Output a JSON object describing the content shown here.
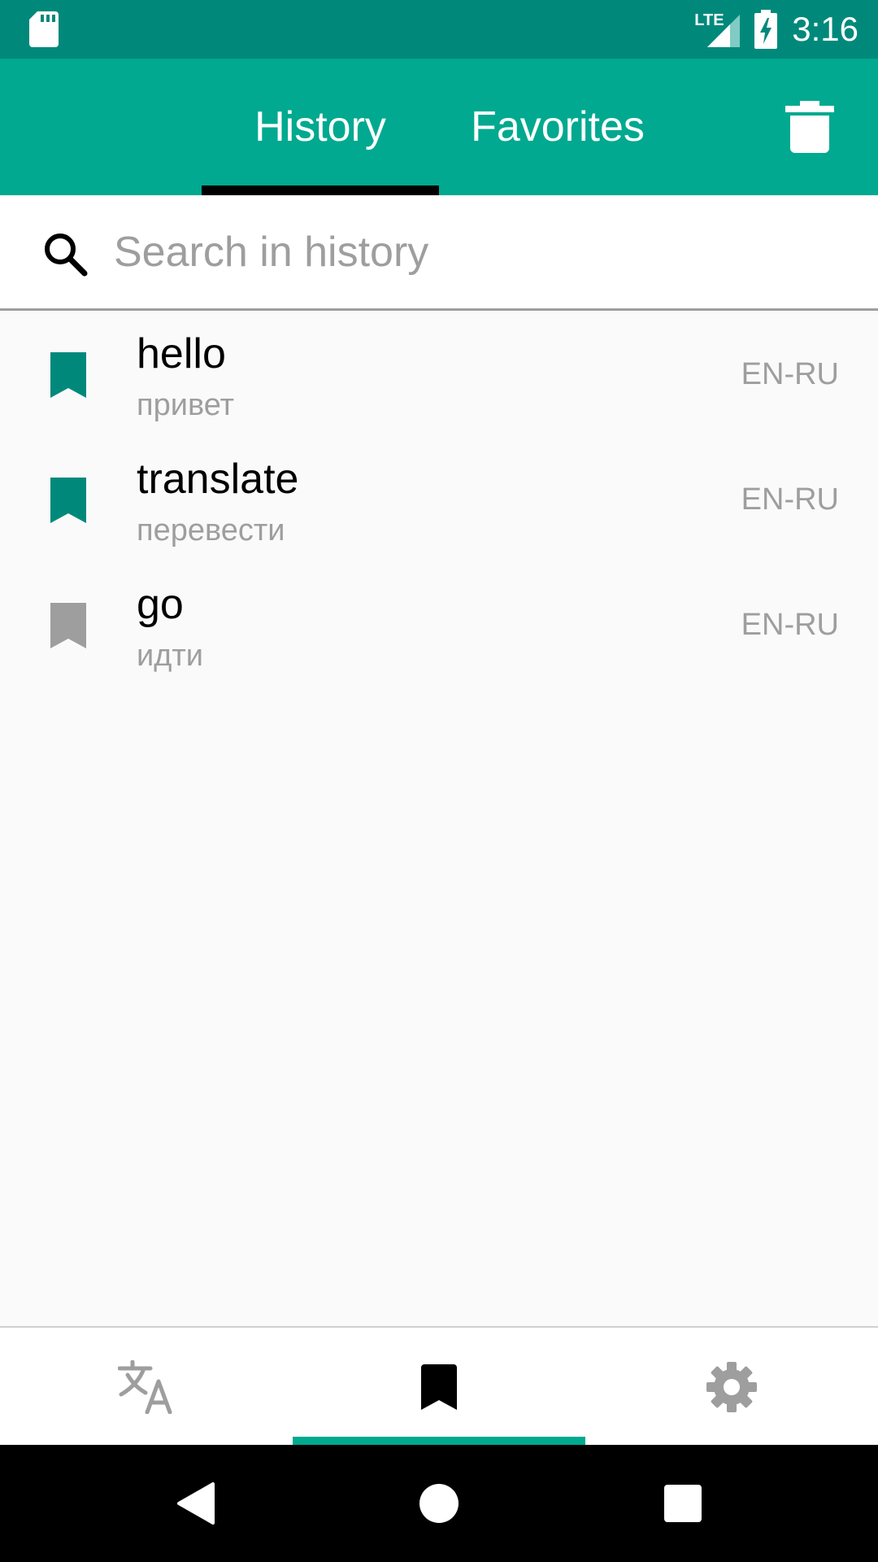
{
  "status_bar": {
    "network": "LTE",
    "time": "3:16"
  },
  "header": {
    "tabs": [
      {
        "label": "History",
        "selected": true
      },
      {
        "label": "Favorites",
        "selected": false
      }
    ]
  },
  "search": {
    "placeholder": "Search in history",
    "value": ""
  },
  "history": {
    "items": [
      {
        "word": "hello",
        "translation": "привет",
        "lang": "EN-RU",
        "favorite": true
      },
      {
        "word": "translate",
        "translation": "перевести",
        "lang": "EN-RU",
        "favorite": true
      },
      {
        "word": "go",
        "translation": "идти",
        "lang": "EN-RU",
        "favorite": false
      }
    ]
  },
  "colors": {
    "status_bar": "#00897b",
    "app_bar": "#00a98f",
    "bookmark_active": "#00897b",
    "bookmark_inactive": "#9e9e9e"
  },
  "bottom_nav": {
    "items": [
      {
        "icon": "translate-icon",
        "selected": false
      },
      {
        "icon": "bookmark-icon",
        "selected": true
      },
      {
        "icon": "gear-icon",
        "selected": false
      }
    ]
  }
}
